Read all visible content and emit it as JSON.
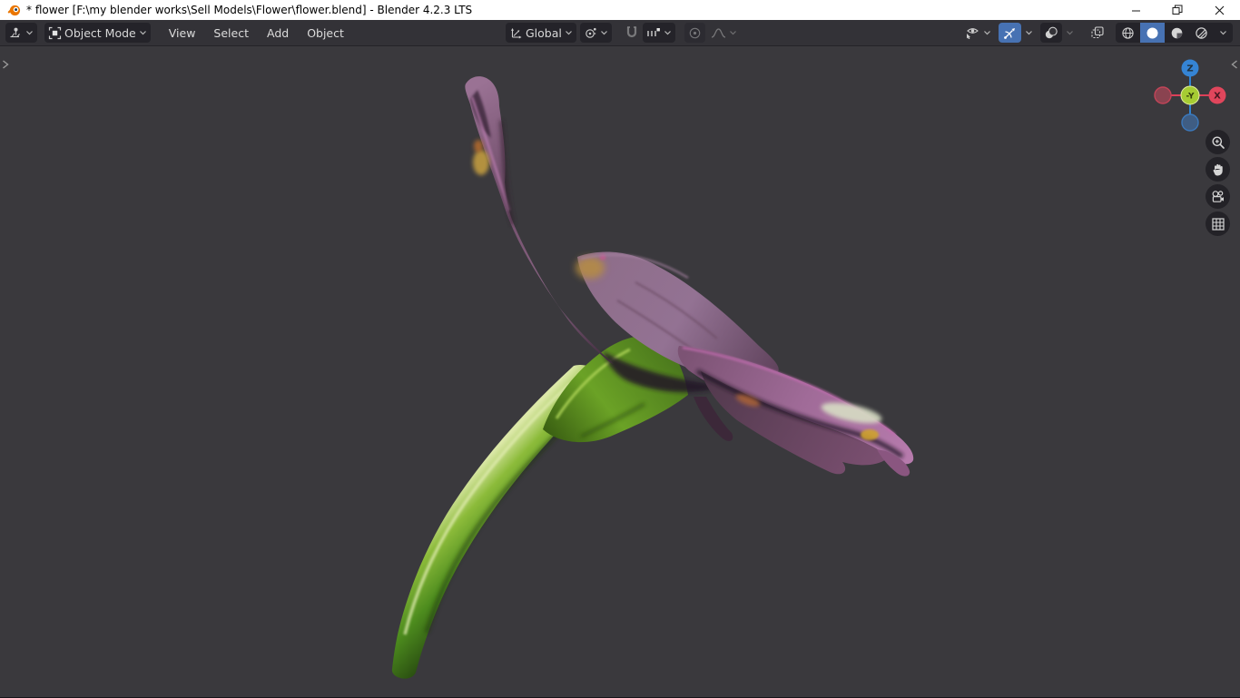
{
  "window": {
    "title": "* flower [F:\\my blender works\\Sell Models\\Flower\\flower.blend] - Blender 4.2.3 LTS",
    "app": "Blender",
    "version": "4.2.3 LTS",
    "controls": [
      "minimize",
      "restore",
      "close"
    ]
  },
  "header": {
    "editor_type": "3D Viewport",
    "mode_selector": {
      "label": "Object Mode"
    },
    "menus": [
      {
        "label": "View"
      },
      {
        "label": "Select"
      },
      {
        "label": "Add"
      },
      {
        "label": "Object"
      }
    ],
    "orientation": {
      "label": "Global"
    },
    "toggles": {
      "pivot_point": "transform-pivot-point",
      "snap": "snapping (off)",
      "snap_with": "snap increments",
      "proportional_editing": "proportional editing (off)",
      "falloff": "proportional falloff (disabled)"
    },
    "right_controls": {
      "visibility": "show object types",
      "gizmos": "viewport gizmos (on)",
      "overlays": "viewport overlays",
      "xray": "toggle x-ray",
      "shading_modes": [
        "wireframe",
        "solid",
        "material-preview",
        "rendered"
      ],
      "active_shading": "solid"
    }
  },
  "viewport": {
    "scene_object": "wilted purple flower with green stem",
    "gizmo_axes": {
      "x": "X",
      "neg_y": "-Y",
      "z": "Z"
    },
    "side_controls": [
      "zoom",
      "move-view",
      "camera-view",
      "toggle-projection"
    ]
  },
  "colors": {
    "accent_blue": "#4772b3",
    "axis_x": "#e0465c",
    "axis_x_dim": "#8a4350",
    "axis_y": "#a6cc33",
    "axis_z": "#3584d4",
    "axis_z_dim": "#3f5d83",
    "header_bg": "#333237",
    "viewport_bg": "#3a393d",
    "button_bg": "#242329",
    "titlebar_bg": "#ffffff",
    "blender_orange": "#ea7600"
  }
}
